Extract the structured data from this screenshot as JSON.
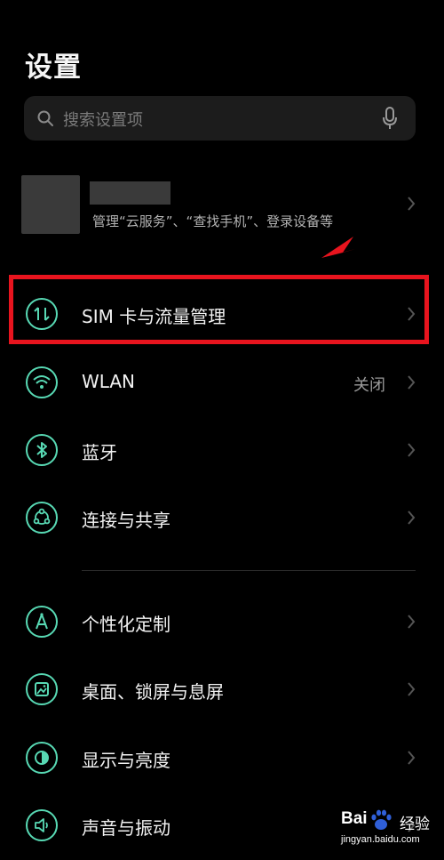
{
  "header": {
    "title": "设置"
  },
  "search": {
    "placeholder": "搜索设置项"
  },
  "account": {
    "subtitle": "管理“云服务”、“查找手机”、登录设备等"
  },
  "items": [
    {
      "id": "sim",
      "label": "SIM 卡与流量管理",
      "value": "",
      "icon": "sim-data-icon"
    },
    {
      "id": "wlan",
      "label": "WLAN",
      "value": "关闭",
      "icon": "wifi-icon"
    },
    {
      "id": "bluetooth",
      "label": "蓝牙",
      "value": "",
      "icon": "bluetooth-icon"
    },
    {
      "id": "share",
      "label": "连接与共享",
      "value": "",
      "icon": "share-icon"
    },
    {
      "id": "personalize",
      "label": "个性化定制",
      "value": "",
      "icon": "personalize-icon"
    },
    {
      "id": "wallpaper",
      "label": "桌面、锁屏与息屏",
      "value": "",
      "icon": "wallpaper-icon"
    },
    {
      "id": "display",
      "label": "显示与亮度",
      "value": "",
      "icon": "brightness-icon"
    },
    {
      "id": "sound",
      "label": "声音与振动",
      "value": "",
      "icon": "speaker-icon"
    }
  ],
  "watermark": {
    "brand": "Bai",
    "site": "经验",
    "url": "jingyan.baidu.com"
  },
  "colors": {
    "background": "#000000",
    "accent": "#58d9b4",
    "highlight": "#e8141e",
    "search_bg": "#1c1c1c"
  }
}
